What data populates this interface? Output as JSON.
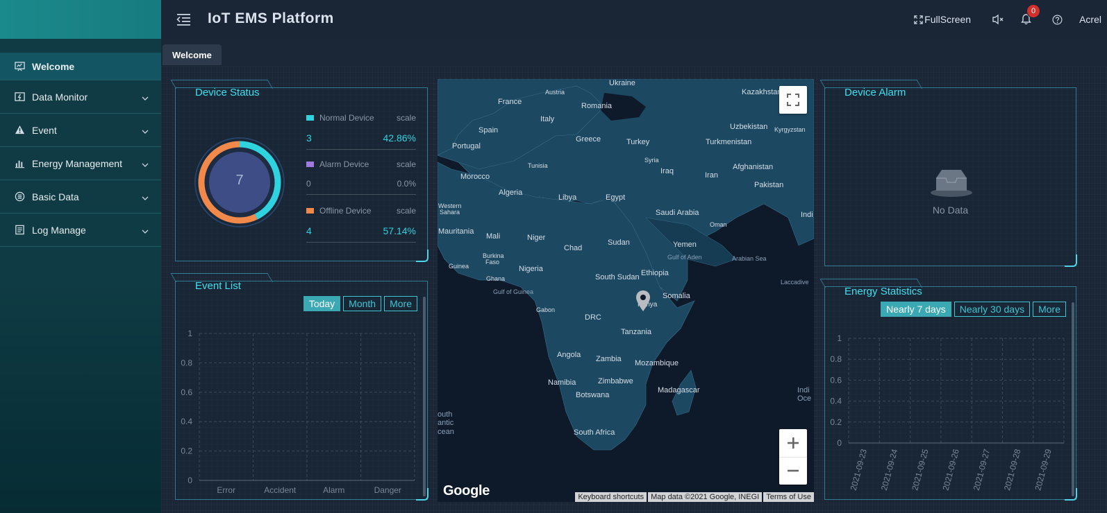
{
  "header": {
    "title": "IoT EMS Platform",
    "fullscreen_label": "FullScreen",
    "notification_count": "0",
    "user": "Acrel"
  },
  "sidebar": {
    "items": [
      {
        "label": "Welcome"
      },
      {
        "label": "Data Monitor"
      },
      {
        "label": "Event"
      },
      {
        "label": "Energy Management"
      },
      {
        "label": "Basic Data"
      },
      {
        "label": "Log Manage"
      }
    ]
  },
  "tabs": [
    {
      "label": "Welcome"
    }
  ],
  "device_status": {
    "title": "Device Status",
    "total": "7",
    "items": [
      {
        "label": "Normal Device",
        "scale_label": "scale",
        "count": "3",
        "percent": "42.86%",
        "color": "#2fd3e0"
      },
      {
        "label": "Alarm Device",
        "scale_label": "scale",
        "count": "0",
        "percent": "0.0%",
        "color": "#a07ae0"
      },
      {
        "label": "Offline Device",
        "scale_label": "scale",
        "count": "4",
        "percent": "57.14%",
        "color": "#f0894a"
      }
    ]
  },
  "event_list": {
    "title": "Event List",
    "buttons": [
      {
        "label": "Today"
      },
      {
        "label": "Month"
      },
      {
        "label": "More"
      }
    ],
    "chart_data": {
      "type": "bar",
      "categories": [
        "Error",
        "Accident",
        "Alarm",
        "Danger"
      ],
      "values": [],
      "ylim": [
        0,
        1
      ],
      "yticks": [
        "0",
        "0.2",
        "0.4",
        "0.6",
        "0.8",
        "1"
      ]
    }
  },
  "device_alarm": {
    "title": "Device Alarm",
    "empty_text": "No Data"
  },
  "energy_statistics": {
    "title": "Energy Statistics",
    "buttons": [
      {
        "label": "Nearly 7 days"
      },
      {
        "label": "Nearly 30 days"
      },
      {
        "label": "More"
      }
    ],
    "chart_data": {
      "type": "bar",
      "categories": [
        "2021-09-23",
        "2021-09-24",
        "2021-09-25",
        "2021-09-26",
        "2021-09-27",
        "2021-09-28",
        "2021-09-29"
      ],
      "values": [],
      "ylim": [
        0,
        1
      ],
      "yticks": [
        "0",
        "0.2",
        "0.4",
        "0.6",
        "0.8",
        "1"
      ]
    }
  },
  "map": {
    "labels": {
      "ukraine": "Ukraine",
      "austria": "Austria",
      "kazakhstan": "Kazakhstan",
      "france": "France",
      "romania": "Romania",
      "italy": "Italy",
      "spain": "Spain",
      "uzbekistan": "Uzbekistan",
      "kyrgyzstan": "Kyrgyzstan",
      "portugal": "Portugal",
      "greece": "Greece",
      "turkey": "Turkey",
      "turkmenistan": "Turkmenistan",
      "tunisia": "Tunisia",
      "syria": "Syria",
      "iraq": "Iraq",
      "afghanistan": "Afghanistan",
      "morocco": "Morocco",
      "iran": "Iran",
      "pakistan": "Pakistan",
      "algeria": "Algeria",
      "libya": "Libya",
      "egypt": "Egypt",
      "western_sahara_1": "Western",
      "western_sahara_2": "Sahara",
      "saudi_arabia": "Saudi Arabia",
      "india": "Indi",
      "oman": "Oman",
      "mauritania": "Mauritania",
      "mali": "Mali",
      "niger": "Niger",
      "sudan": "Sudan",
      "yemen": "Yemen",
      "chad": "Chad",
      "gulf_of_aden": "Gulf of Aden",
      "arabian_sea": "Arabian Sea",
      "burkina_1": "Burkina",
      "burkina_2": "Faso",
      "nigeria": "Nigeria",
      "guinea": "Guinea",
      "ethiopia": "Ethiopia",
      "south_sudan": "South Sudan",
      "ghana": "Ghana",
      "laccadive": "Laccadive",
      "gulf_of_guinea": "Gulf of Guinea",
      "somalia": "Somalia",
      "kenya": "Kenya",
      "gabon": "Gabon",
      "drc": "DRC",
      "tanzania": "Tanzania",
      "angola": "Angola",
      "zambia": "Zambia",
      "mozambique": "Mozambique",
      "namibia": "Namibia",
      "zimbabwe": "Zimbabwe",
      "botswana": "Botswana",
      "madagascar": "Madagascar",
      "indian_1": "Indi",
      "indian_2": "Oce",
      "atlantic_1": "outh",
      "atlantic_2": "antic",
      "atlantic_3": "cean",
      "south_africa": "South Africa"
    },
    "google": "Google",
    "attribution": [
      {
        "label": "Keyboard shortcuts"
      },
      {
        "label": "Map data ©2021 Google, INEGI"
      },
      {
        "label": "Terms of Use"
      }
    ]
  }
}
